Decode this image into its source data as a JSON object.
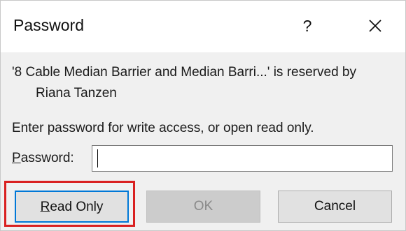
{
  "dialog": {
    "title": "Password",
    "help_label": "?",
    "close_icon": "close-icon"
  },
  "message": {
    "line1": "'8 Cable Median Barrier and Median Barri...' is reserved by",
    "line2": "Riana Tanzen"
  },
  "prompt": "Enter password for write access, or open read only.",
  "password": {
    "label_accel": "P",
    "label_rest": "assword:",
    "value": "",
    "placeholder": ""
  },
  "buttons": {
    "read_only_accel": "R",
    "read_only_rest": "ead Only",
    "ok": "OK",
    "cancel": "Cancel"
  },
  "colors": {
    "focus_border": "#0078d7",
    "highlight": "#d92020"
  }
}
